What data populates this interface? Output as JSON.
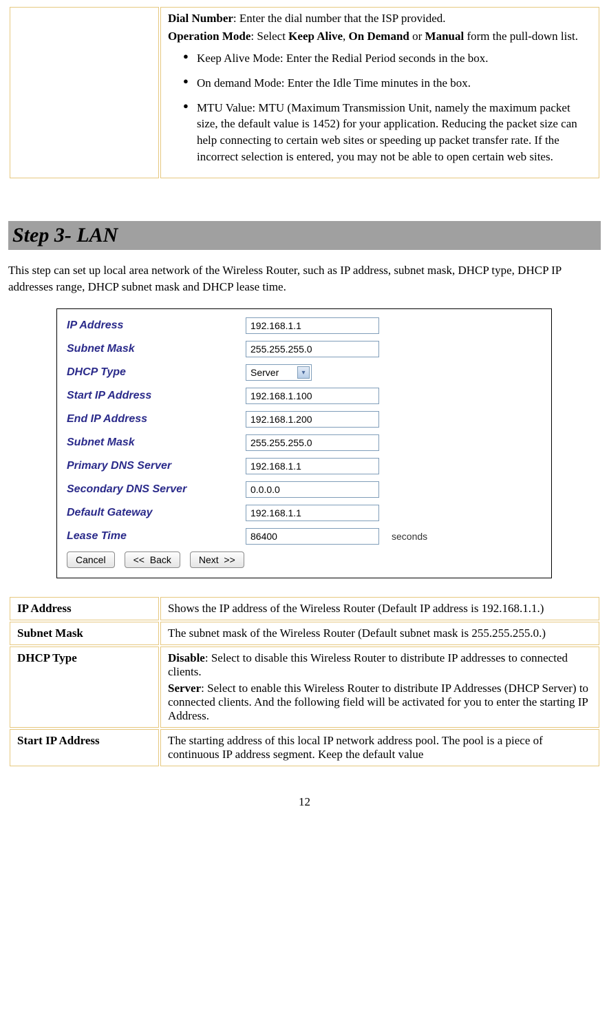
{
  "top_box": {
    "dial_number_label": "Dial Number",
    "dial_number_text": ": Enter the dial number that the ISP provided.",
    "op_mode_label": "Operation Mode",
    "op_mode_mid": ": Select ",
    "op_mode_opts": [
      "Keep Alive",
      "On Demand",
      "Manual"
    ],
    "op_mode_tail": " form the pull-down list.",
    "bullet1": "Keep Alive Mode: Enter the Redial Period  seconds in the box.",
    "bullet2": "On demand Mode: Enter the Idle Time minutes in the box.",
    "bullet3": "MTU Value:  MTU (Maximum Transmission Unit, namely the maximum packet size, the default value is 1452) for your application. Reducing the packet size can help connecting to certain web sites or speeding up packet transfer rate. If the incorrect selection is entered, you may not be able to open certain web sites."
  },
  "step_heading": "Step 3- LAN",
  "intro": "This step can set up local area network of the Wireless  Router, such as IP address, subnet mask, DHCP type, DHCP IP addresses range, DHCP subnet mask and DHCP lease time.",
  "form": {
    "rows": [
      {
        "label": "IP Address",
        "value": "192.168.1.1",
        "type": "text"
      },
      {
        "label": "Subnet Mask",
        "value": "255.255.255.0",
        "type": "text"
      },
      {
        "label": "DHCP Type",
        "value": "Server",
        "type": "select"
      },
      {
        "label": "Start IP Address",
        "value": "192.168.1.100",
        "type": "text"
      },
      {
        "label": "End IP Address",
        "value": "192.168.1.200",
        "type": "text"
      },
      {
        "label": "Subnet Mask",
        "value": "255.255.255.0",
        "type": "text"
      },
      {
        "label": "Primary DNS Server",
        "value": "192.168.1.1",
        "type": "text"
      },
      {
        "label": "Secondary DNS Server",
        "value": "0.0.0.0",
        "type": "text"
      },
      {
        "label": "Default Gateway",
        "value": "192.168.1.1",
        "type": "text"
      },
      {
        "label": "Lease Time",
        "value": "86400",
        "type": "text",
        "unit": "seconds"
      }
    ],
    "buttons": {
      "cancel": "Cancel",
      "back": "<<  Back",
      "next": "Next  >>"
    }
  },
  "desc_table": [
    {
      "label": "IP Address",
      "text": "Shows the IP address of the Wireless  Router (Default IP address is 192.168.1.1.)"
    },
    {
      "label": "Subnet Mask",
      "text": "The subnet mask of the Wireless  Router (Default subnet mask is 255.255.255.0.)"
    },
    {
      "label": "DHCP Type",
      "d1b": "Disable",
      "d1": ": Select to disable this Wireless  Router to distribute IP addresses to connected clients.",
      "d2b": "Server",
      "d2": ": Select to enable this Wireless  Router to distribute IP Addresses (DHCP Server) to connected clients. And the following field will be activated for you to enter the starting IP Address."
    },
    {
      "label": "Start IP Address",
      "text": "The starting address of this local IP network address pool. The pool is a piece of continuous IP address segment. Keep the default value"
    }
  ],
  "or_word": " or ",
  "comma_sep": ", ",
  "page_number": "12"
}
